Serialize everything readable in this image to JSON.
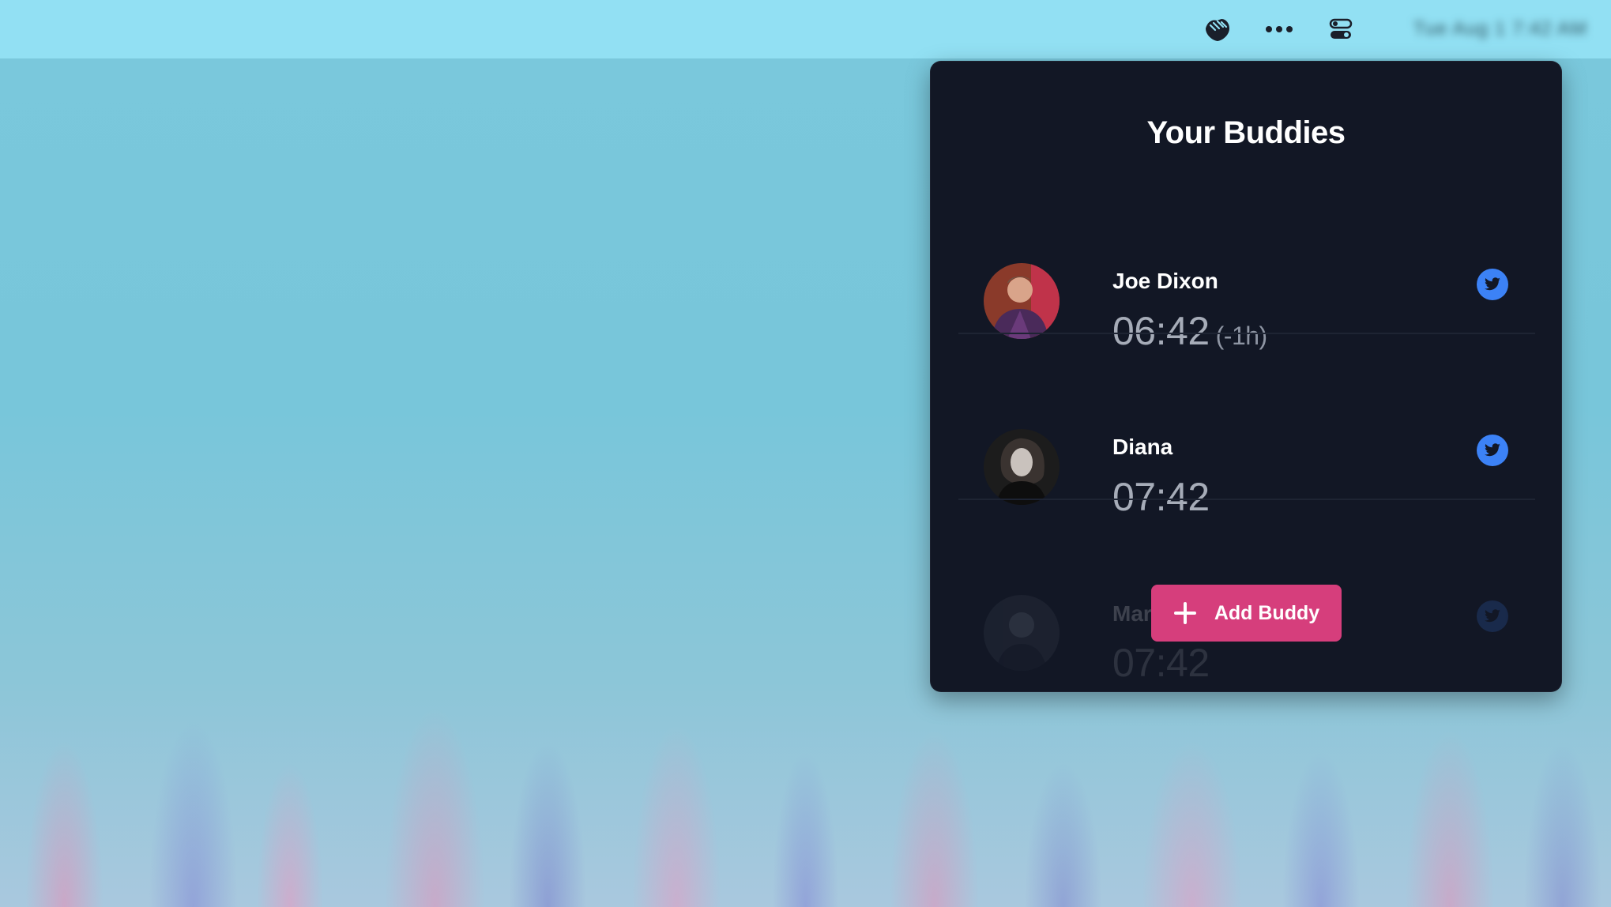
{
  "menubar": {
    "icons": [
      "handshake-icon",
      "more-icon",
      "control-center-icon"
    ],
    "clock_text": "Tue Aug 1 7:42 AM"
  },
  "popover": {
    "title": "Your Buddies",
    "buddies": [
      {
        "name": "Joe Dixon",
        "time": "06:42",
        "offset": "(-1h)",
        "social": "twitter-icon"
      },
      {
        "name": "Diana",
        "time": "07:42",
        "offset": "",
        "social": "twitter-icon"
      },
      {
        "name": "Marcel Pociot 🔥",
        "time": "07:42",
        "offset": "",
        "social": "twitter-icon"
      }
    ],
    "add_button_label": "Add Buddy"
  },
  "colors": {
    "menubar": "#92e0f3",
    "popover_bg": "#121725",
    "accent_pink": "#d63e7c",
    "twitter_blue": "#3c82f6"
  }
}
